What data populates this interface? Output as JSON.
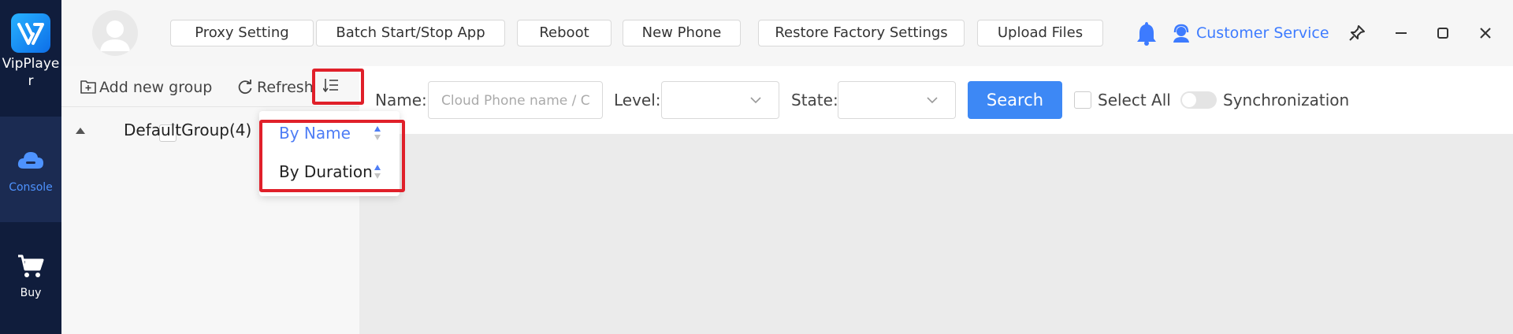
{
  "sidebar": {
    "app_name": "VipPlayer",
    "nav": [
      {
        "label": "Console",
        "icon": "cloud-icon",
        "active": true
      },
      {
        "label": "Buy",
        "icon": "cart-icon",
        "active": false
      }
    ]
  },
  "toolbar": {
    "buttons": [
      "Proxy Setting",
      "Batch Start/Stop App",
      "Reboot",
      "New Phone",
      "Restore Factory Settings",
      "Upload Files"
    ],
    "customer_service": "Customer Service"
  },
  "group_panel": {
    "add_group": "Add new group",
    "refresh": "Refresh",
    "groups": [
      {
        "label": "DefaultGroup(4)"
      }
    ]
  },
  "sort_menu": {
    "items": [
      {
        "label": "By Name",
        "active": true
      },
      {
        "label": "By Duration",
        "active": false
      }
    ]
  },
  "filters": {
    "name_label": "Name:",
    "name_placeholder": "Cloud Phone name / C",
    "level_label": "Level:",
    "level_value": "",
    "state_label": "State:",
    "state_value": "",
    "search_label": "Search",
    "select_all": "Select All",
    "sync_label": "Synchronization"
  },
  "colors": {
    "sidebar_bg": "#101d3c",
    "accent": "#3d88f5",
    "highlight": "#e0202a"
  }
}
